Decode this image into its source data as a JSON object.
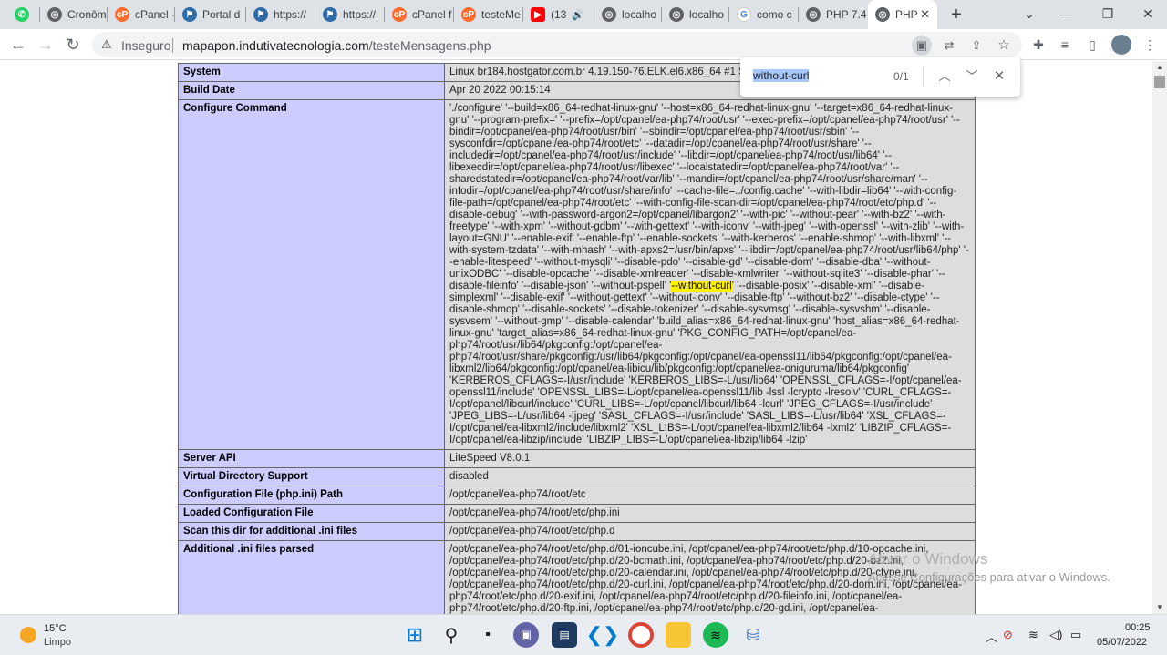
{
  "tabs": [
    {
      "icon": "whatsapp-icon",
      "label": "",
      "color": "#25d366"
    },
    {
      "icon": "globe-icon",
      "label": "Cronôm",
      "color": "#5f6368"
    },
    {
      "icon": "cpanel-icon",
      "label": "cPanel ·",
      "color": "#ff6c2c"
    },
    {
      "icon": "portal-icon",
      "label": "Portal d",
      "color": "#2f6ca8"
    },
    {
      "icon": "portal-icon",
      "label": "https://",
      "color": "#2f6ca8"
    },
    {
      "icon": "portal-icon",
      "label": "https://",
      "color": "#2f6ca8"
    },
    {
      "icon": "cpanel-icon",
      "label": "cPanel f",
      "color": "#ff6c2c"
    },
    {
      "icon": "cpanel-icon",
      "label": "testeMe",
      "color": "#ff6c2c"
    },
    {
      "icon": "youtube-icon",
      "label": "(13",
      "color": "#ff0000"
    },
    {
      "icon": "globe-icon",
      "label": "localho",
      "color": "#5f6368"
    },
    {
      "icon": "globe-icon",
      "label": "localho",
      "color": "#5f6368"
    },
    {
      "icon": "google-icon",
      "label": "como c",
      "color": "#4285f4"
    },
    {
      "icon": "globe-icon",
      "label": "PHP 7.4",
      "color": "#5f6368"
    },
    {
      "icon": "globe-icon",
      "label": "PHP",
      "color": "#5f6368",
      "active": true
    }
  ],
  "toolbar": {
    "security_label": "Inseguro",
    "url_host": "mapapon.indutivatecnologia.com",
    "url_path": "/testeMensagens.php"
  },
  "find": {
    "query": "without-curl",
    "count": "0/1"
  },
  "phpinfo": [
    {
      "label": "System",
      "value": "Linux br184.hostgator.com.br 4.19.150-76.ELK.el6.x86_64 #1 SMP Wed Nov 18 11:43:20 CST 2020 x86_64"
    },
    {
      "label": "Build Date",
      "value": "Apr 20 2022 00:15:14"
    },
    {
      "label": "Configure Command",
      "value_pre": "'./configure' '--build=x86_64-redhat-linux-gnu' '--host=x86_64-redhat-linux-gnu' '--target=x86_64-redhat-linux-gnu' '--program-prefix=' '--prefix=/opt/cpanel/ea-php74/root/usr' '--exec-prefix=/opt/cpanel/ea-php74/root/usr' '--bindir=/opt/cpanel/ea-php74/root/usr/bin' '--sbindir=/opt/cpanel/ea-php74/root/usr/sbin' '--sysconfdir=/opt/cpanel/ea-php74/root/etc' '--datadir=/opt/cpanel/ea-php74/root/usr/share' '--includedir=/opt/cpanel/ea-php74/root/usr/include' '--libdir=/opt/cpanel/ea-php74/root/usr/lib64' '--libexecdir=/opt/cpanel/ea-php74/root/usr/libexec' '--localstatedir=/opt/cpanel/ea-php74/root/var' '--sharedstatedir=/opt/cpanel/ea-php74/root/var/lib' '--mandir=/opt/cpanel/ea-php74/root/usr/share/man' '--infodir=/opt/cpanel/ea-php74/root/usr/share/info' '--cache-file=../config.cache' '--with-libdir=lib64' '--with-config-file-path=/opt/cpanel/ea-php74/root/etc' '--with-config-file-scan-dir=/opt/cpanel/ea-php74/root/etc/php.d' '--disable-debug' '--with-password-argon2=/opt/cpanel/libargon2' '--with-pic' '--without-pear' '--with-bz2' '--with-freetype' '--with-xpm' '--without-gdbm' '--with-gettext' '--with-iconv' '--with-jpeg' '--with-openssl' '--with-zlib' '--with-layout=GNU' '--enable-exif' '--enable-ftp' '--enable-sockets' '--with-kerberos' '--enable-shmop' '--with-libxml' '--with-system-tzdata' '--with-mhash' '--with-apxs2=/usr/bin/apxs' '--libdir=/opt/cpanel/ea-php74/root/usr/lib64/php' '--enable-litespeed' '--without-mysqli' '--disable-pdo' '--disable-gd' '--disable-dom' '--disable-dba' '--without-unixODBC' '--disable-opcache' '--disable-xmlreader' '--disable-xmlwriter' '--without-sqlite3' '--disable-phar' '--disable-fileinfo' '--disable-json' '--without-pspell' '",
      "value_hl": "--without-curl",
      "value_post": "' '--disable-posix' '--disable-xml' '--disable-simplexml' '--disable-exif' '--without-gettext' '--without-iconv' '--disable-ftp' '--without-bz2' '--disable-ctype' '--disable-shmop' '--disable-sockets' '--disable-tokenizer' '--disable-sysvmsg' '--disable-sysvshm' '--disable-sysvsem' '--without-gmp' '--disable-calendar' 'build_alias=x86_64-redhat-linux-gnu' 'host_alias=x86_64-redhat-linux-gnu' 'target_alias=x86_64-redhat-linux-gnu' 'PKG_CONFIG_PATH=/opt/cpanel/ea-php74/root/usr/lib64/pkgconfig:/opt/cpanel/ea-php74/root/usr/share/pkgconfig:/usr/lib64/pkgconfig:/opt/cpanel/ea-openssl11/lib64/pkgconfig:/opt/cpanel/ea-libxml2/lib64/pkgconfig:/opt/cpanel/ea-libicu/lib/pkgconfig:/opt/cpanel/ea-oniguruma/lib64/pkgconfig' 'KERBEROS_CFLAGS=-I/usr/include' 'KERBEROS_LIBS=-L/usr/lib64' 'OPENSSL_CFLAGS=-I/opt/cpanel/ea-openssl11/include' 'OPENSSL_LIBS=-L/opt/cpanel/ea-openssl11/lib -lssl -lcrypto -lresolv' 'CURL_CFLAGS=-I/opt/cpanel/libcurl/include' 'CURL_LIBS=-L/opt/cpanel/libcurl/lib64 -lcurl' 'JPEG_CFLAGS=-I/usr/include' 'JPEG_LIBS=-L/usr/lib64 -ljpeg' 'SASL_CFLAGS=-I/usr/include' 'SASL_LIBS=-L/usr/lib64' 'XSL_CFLAGS=-I/opt/cpanel/ea-libxml2/include/libxml2' 'XSL_LIBS=-L/opt/cpanel/ea-libxml2/lib64 -lxml2' 'LIBZIP_CFLAGS=-I/opt/cpanel/ea-libzip/include' 'LIBZIP_LIBS=-L/opt/cpanel/ea-libzip/lib64 -lzip'"
    },
    {
      "label": "Server API",
      "value": "LiteSpeed V8.0.1"
    },
    {
      "label": "Virtual Directory Support",
      "value": "disabled"
    },
    {
      "label": "Configuration File (php.ini) Path",
      "value": "/opt/cpanel/ea-php74/root/etc"
    },
    {
      "label": "Loaded Configuration File",
      "value": "/opt/cpanel/ea-php74/root/etc/php.ini"
    },
    {
      "label": "Scan this dir for additional .ini files",
      "value": "/opt/cpanel/ea-php74/root/etc/php.d"
    },
    {
      "label": "Additional .ini files parsed",
      "value": "/opt/cpanel/ea-php74/root/etc/php.d/01-ioncube.ini, /opt/cpanel/ea-php74/root/etc/php.d/10-opcache.ini, /opt/cpanel/ea-php74/root/etc/php.d/20-bcmath.ini, /opt/cpanel/ea-php74/root/etc/php.d/20-bz2.ini, /opt/cpanel/ea-php74/root/etc/php.d/20-calendar.ini, /opt/cpanel/ea-php74/root/etc/php.d/20-ctype.ini, /opt/cpanel/ea-php74/root/etc/php.d/20-curl.ini, /opt/cpanel/ea-php74/root/etc/php.d/20-dom.ini, /opt/cpanel/ea-php74/root/etc/php.d/20-exif.ini, /opt/cpanel/ea-php74/root/etc/php.d/20-fileinfo.ini, /opt/cpanel/ea-php74/root/etc/php.d/20-ftp.ini, /opt/cpanel/ea-php74/root/etc/php.d/20-gd.ini, /opt/cpanel/ea-php74/root/etc/php.d/20-gettext.ini, /opt/cpanel/ea-php74/root/etc/php.d/20-gmp.ini, /opt/cpanel/ea-"
    }
  ],
  "watermark": {
    "title": "Ativar o Windows",
    "subtitle": "Acesse Configurações para ativar o Windows."
  },
  "taskbar": {
    "temperature": "15°C",
    "condition": "Limpo",
    "time": "00:25",
    "date": "05/07/2022"
  }
}
